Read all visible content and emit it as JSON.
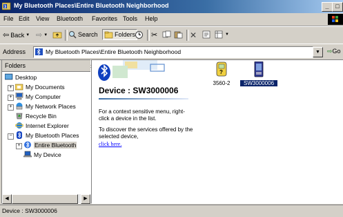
{
  "window": {
    "title": "My Bluetooth Places\\Entire Bluetooth Neighborhood",
    "min_label": "_",
    "max_label": "□"
  },
  "menubar": {
    "items": [
      "File",
      "Edit",
      "View",
      "Bluetooth",
      "Favorites",
      "Tools",
      "Help"
    ]
  },
  "toolbar": {
    "back_label": "Back",
    "search_label": "Search",
    "folders_label": "Folders"
  },
  "addressbar": {
    "label": "Address",
    "value": "My Bluetooth Places\\Entire Bluetooth Neighborhood",
    "go_label": "Go"
  },
  "folders_pane": {
    "title": "Folders",
    "close_label": "×",
    "tree": [
      {
        "label": "Desktop",
        "icon": "desktop-icon"
      },
      {
        "label": "My Documents",
        "icon": "folder-icon"
      },
      {
        "label": "My Computer",
        "icon": "computer-icon"
      },
      {
        "label": "My Network Places",
        "icon": "network-places-icon"
      },
      {
        "label": "Recycle Bin",
        "icon": "recycle-bin-icon"
      },
      {
        "label": "Internet Explorer",
        "icon": "internet-explorer-icon"
      },
      {
        "label": "My Bluetooth Places",
        "icon": "bluetooth-icon"
      },
      {
        "label": "Entire Bluetooth",
        "icon": "bluetooth-neighborhood-icon"
      },
      {
        "label": "My Device",
        "icon": "laptop-icon"
      }
    ]
  },
  "content": {
    "device_title": "Device : SW3000006",
    "hint_context": "For a context sensitive menu, right-click a device in the list.",
    "hint_discover": "To discover the services offered by the selected device,",
    "click_here": "click here.",
    "devices": [
      {
        "label": "3560-2",
        "icon": "phone-device-icon",
        "selected": false
      },
      {
        "label": "SW3000006",
        "icon": "pda-device-icon",
        "selected": true
      }
    ]
  },
  "statusbar": {
    "text": "Device : SW3000006"
  },
  "colors": {
    "titlebar_start": "#0a246a",
    "titlebar_end": "#a6caf0",
    "selection": "#0a246a",
    "link": "#0000ff"
  }
}
